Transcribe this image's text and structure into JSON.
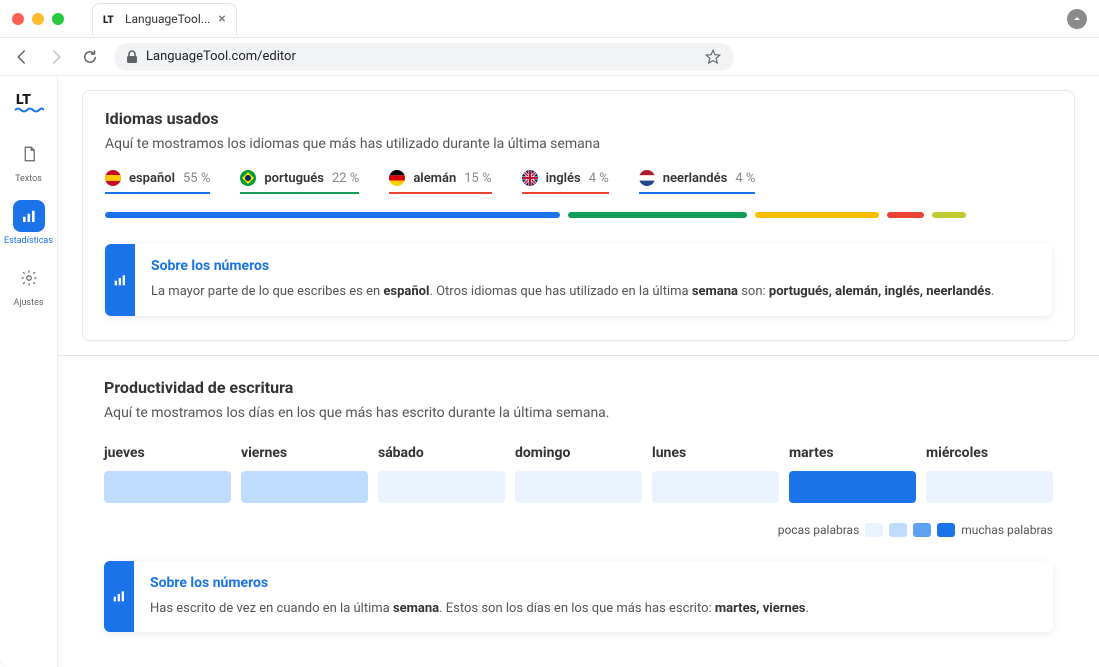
{
  "browser": {
    "tab_title": "LanguageTool...",
    "url": "LanguageTool.com/editor"
  },
  "sidebar": {
    "items": [
      {
        "label": "Textos"
      },
      {
        "label": "Estadísticas"
      },
      {
        "label": "Ajustes"
      }
    ]
  },
  "languages_panel": {
    "title": "Idiomas usados",
    "subtitle": "Aquí te mostramos los idiomas que más has utilizado durante la última semana",
    "items": [
      {
        "name": "español",
        "pct": "55 %",
        "color": "#1a73e8",
        "width": 48
      },
      {
        "name": "portugués",
        "pct": "22 %",
        "color": "#0f9d58",
        "width": 19
      },
      {
        "name": "alemán",
        "pct": "15 %",
        "color": "#fbbc04",
        "width": 13
      },
      {
        "name": "inglés",
        "pct": "4 %",
        "color": "#ea4335",
        "width": 4
      },
      {
        "name": "neerlandés",
        "pct": "4 %",
        "color": "#c0ca33",
        "width": 3.5
      }
    ],
    "info": {
      "title": "Sobre los números",
      "prefix": "La mayor parte de lo que escribes es en ",
      "bold1": "español",
      "mid": ". Otros idiomas que has utilizado en la última ",
      "bold2": "semana",
      "mid2": " son: ",
      "bold3": "portugués, alemán, inglés, neerlandés",
      "suffix": "."
    }
  },
  "productivity_panel": {
    "title": "Productividad de escritura",
    "subtitle": "Aquí te mostramos los días en los que más has escrito durante la última semana.",
    "days": [
      {
        "label": "jueves",
        "color": "#bfdcff"
      },
      {
        "label": "viernes",
        "color": "#bfdcff"
      },
      {
        "label": "sábado",
        "color": "#eaf3ff"
      },
      {
        "label": "domingo",
        "color": "#eaf3ff"
      },
      {
        "label": "lunes",
        "color": "#eaf3ff"
      },
      {
        "label": "martes",
        "color": "#1a73e8"
      },
      {
        "label": "miércoles",
        "color": "#eaf3ff"
      }
    ],
    "legend": {
      "few": "pocas palabras",
      "many": "muchas palabras"
    },
    "info": {
      "title": "Sobre los números",
      "prefix": "Has escrito de vez en cuando en la última ",
      "bold1": "semana",
      "mid": ". Estos son los días en los que más has escrito: ",
      "bold2": "martes, viernes",
      "suffix": "."
    }
  },
  "chart_data": [
    {
      "type": "bar",
      "title": "Idiomas usados",
      "categories": [
        "español",
        "portugués",
        "alemán",
        "inglés",
        "neerlandés"
      ],
      "values": [
        55,
        22,
        15,
        4,
        4
      ],
      "ylabel": "%",
      "ylim": [
        0,
        100
      ]
    },
    {
      "type": "heatmap",
      "title": "Productividad de escritura",
      "categories": [
        "jueves",
        "viernes",
        "sábado",
        "domingo",
        "lunes",
        "martes",
        "miércoles"
      ],
      "values": [
        2,
        2,
        1,
        1,
        1,
        4,
        1
      ],
      "scale": {
        "1": "pocas palabras",
        "4": "muchas palabras"
      }
    }
  ]
}
